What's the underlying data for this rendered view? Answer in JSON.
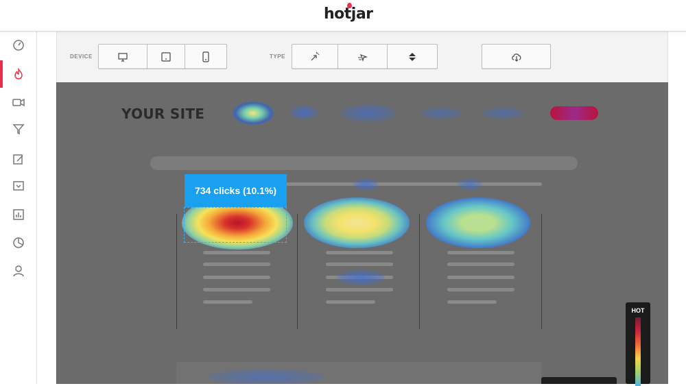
{
  "app": {
    "logo": "hotjar"
  },
  "sidebar": {
    "items": [
      {
        "icon": "dashboard-icon"
      },
      {
        "icon": "heatmap-flame-icon",
        "active": true
      },
      {
        "icon": "recording-icon"
      },
      {
        "icon": "funnel-icon"
      },
      {
        "icon": "form-icon"
      },
      {
        "icon": "poll-icon"
      },
      {
        "icon": "survey-icon"
      },
      {
        "icon": "chart-icon"
      },
      {
        "icon": "user-icon"
      }
    ],
    "accent_color": "#e8304c"
  },
  "toolbar": {
    "device_label": "DEVICE",
    "device_buttons": [
      "desktop-icon",
      "tablet-icon",
      "mobile-icon"
    ],
    "type_label": "TYPE",
    "type_buttons": [
      "click-icon",
      "move-icon",
      "scroll-icon"
    ],
    "download_button": "download-icon"
  },
  "preview": {
    "site_title": "YOUR SITE",
    "tooltip": "734 clicks (10.1%)"
  },
  "legend": {
    "label": "HOT"
  },
  "colors": {
    "tooltip": "#1aa0f0",
    "preview_bg": "#6b6b6b"
  }
}
